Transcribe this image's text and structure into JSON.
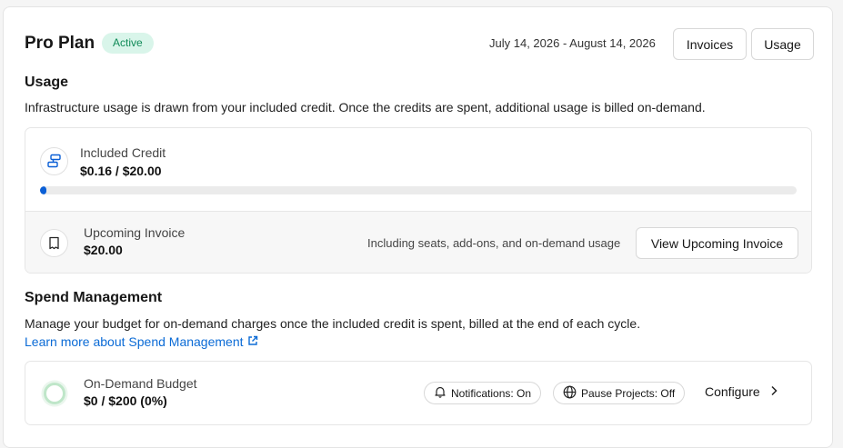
{
  "plan": {
    "title": "Pro Plan",
    "status": "Active",
    "period": "July 14, 2026 - August 14, 2026",
    "invoices_label": "Invoices",
    "usage_label": "Usage"
  },
  "usage": {
    "heading": "Usage",
    "description": "Infrastructure usage is drawn from your included credit. Once the credits are spent, additional usage is billed on-demand.",
    "credit_label": "Included Credit",
    "credit_value": "$0.16 / $20.00",
    "credit_fraction": 0.008,
    "invoice_label": "Upcoming Invoice",
    "invoice_value": "$20.00",
    "invoice_note": "Including seats, add-ons, and on-demand usage",
    "view_invoice_label": "View Upcoming Invoice"
  },
  "spend": {
    "heading": "Spend Management",
    "description": "Manage your budget for on-demand charges once the included credit is spent, billed at the end of each cycle.",
    "learn_more": "Learn more about Spend Management",
    "budget_label": "On-Demand Budget",
    "budget_value": "$0 / $200 (0%)",
    "budget_fraction": 0,
    "notifications": "Notifications: On",
    "pause_projects": "Pause Projects: Off",
    "configure": "Configure"
  },
  "colors": {
    "accent": "#0b5fd6",
    "link": "#0b6bd6",
    "active_badge_bg": "#d9f5ea",
    "active_badge_text": "#0f8a57",
    "budget_ring": "#bfe6c9"
  },
  "icons": [
    "database-icon",
    "receipt-icon",
    "external-link-icon",
    "budget-ring-icon",
    "bell-icon",
    "globe-icon",
    "chevron-right-icon"
  ]
}
